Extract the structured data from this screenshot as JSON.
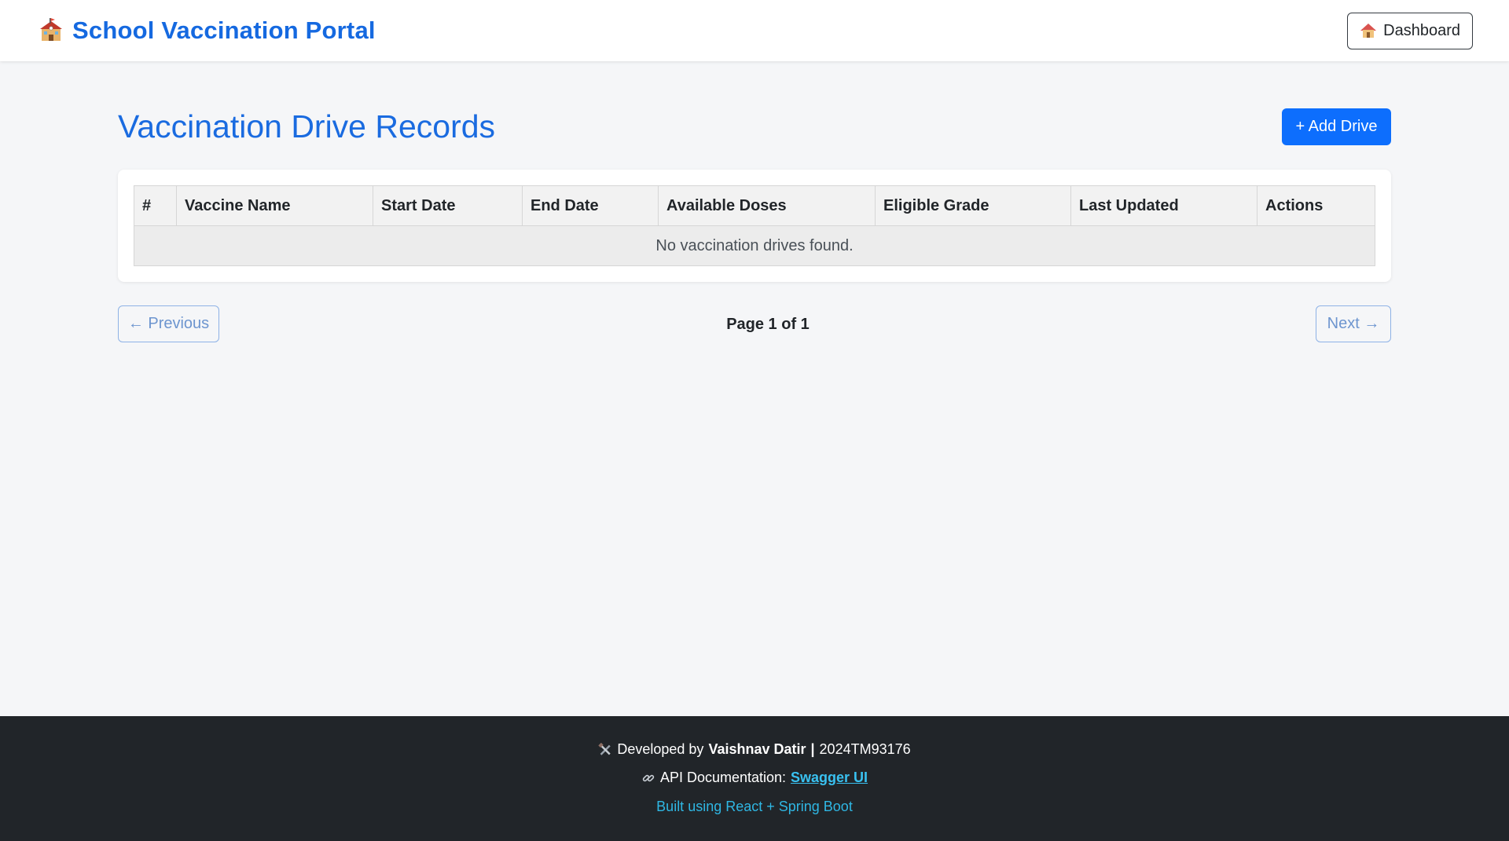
{
  "navbar": {
    "brand_icon": "school-icon",
    "title": "School Vaccination Portal",
    "dashboard_icon": "house-icon",
    "dashboard_label": "Dashboard"
  },
  "main": {
    "page_title": "Vaccination Drive Records",
    "add_button_label": "+ Add Drive",
    "table": {
      "columns": [
        "#",
        "Vaccine Name",
        "Start Date",
        "End Date",
        "Available Doses",
        "Eligible Grade",
        "Last Updated",
        "Actions"
      ],
      "empty_message": "No vaccination drives found."
    },
    "pagination": {
      "previous_label": "← Previous",
      "page_text": "Page 1 of 1",
      "next_label": "Next →"
    }
  },
  "footer": {
    "dev_icon": "tools-icon",
    "developed_by_prefix": "Developed by",
    "developer_name": "Vaishnav Datir",
    "developer_id": "2024TM93176",
    "api_icon": "link-icon",
    "api_prefix": "API Documentation:",
    "api_link_label": "Swagger UI",
    "built_with": "Built using React + Spring Boot"
  },
  "colors": {
    "brand": "#1569e0",
    "primary_button": "#0d6efd",
    "footer_bg": "#212529",
    "footer_link": "#39c1f0"
  }
}
